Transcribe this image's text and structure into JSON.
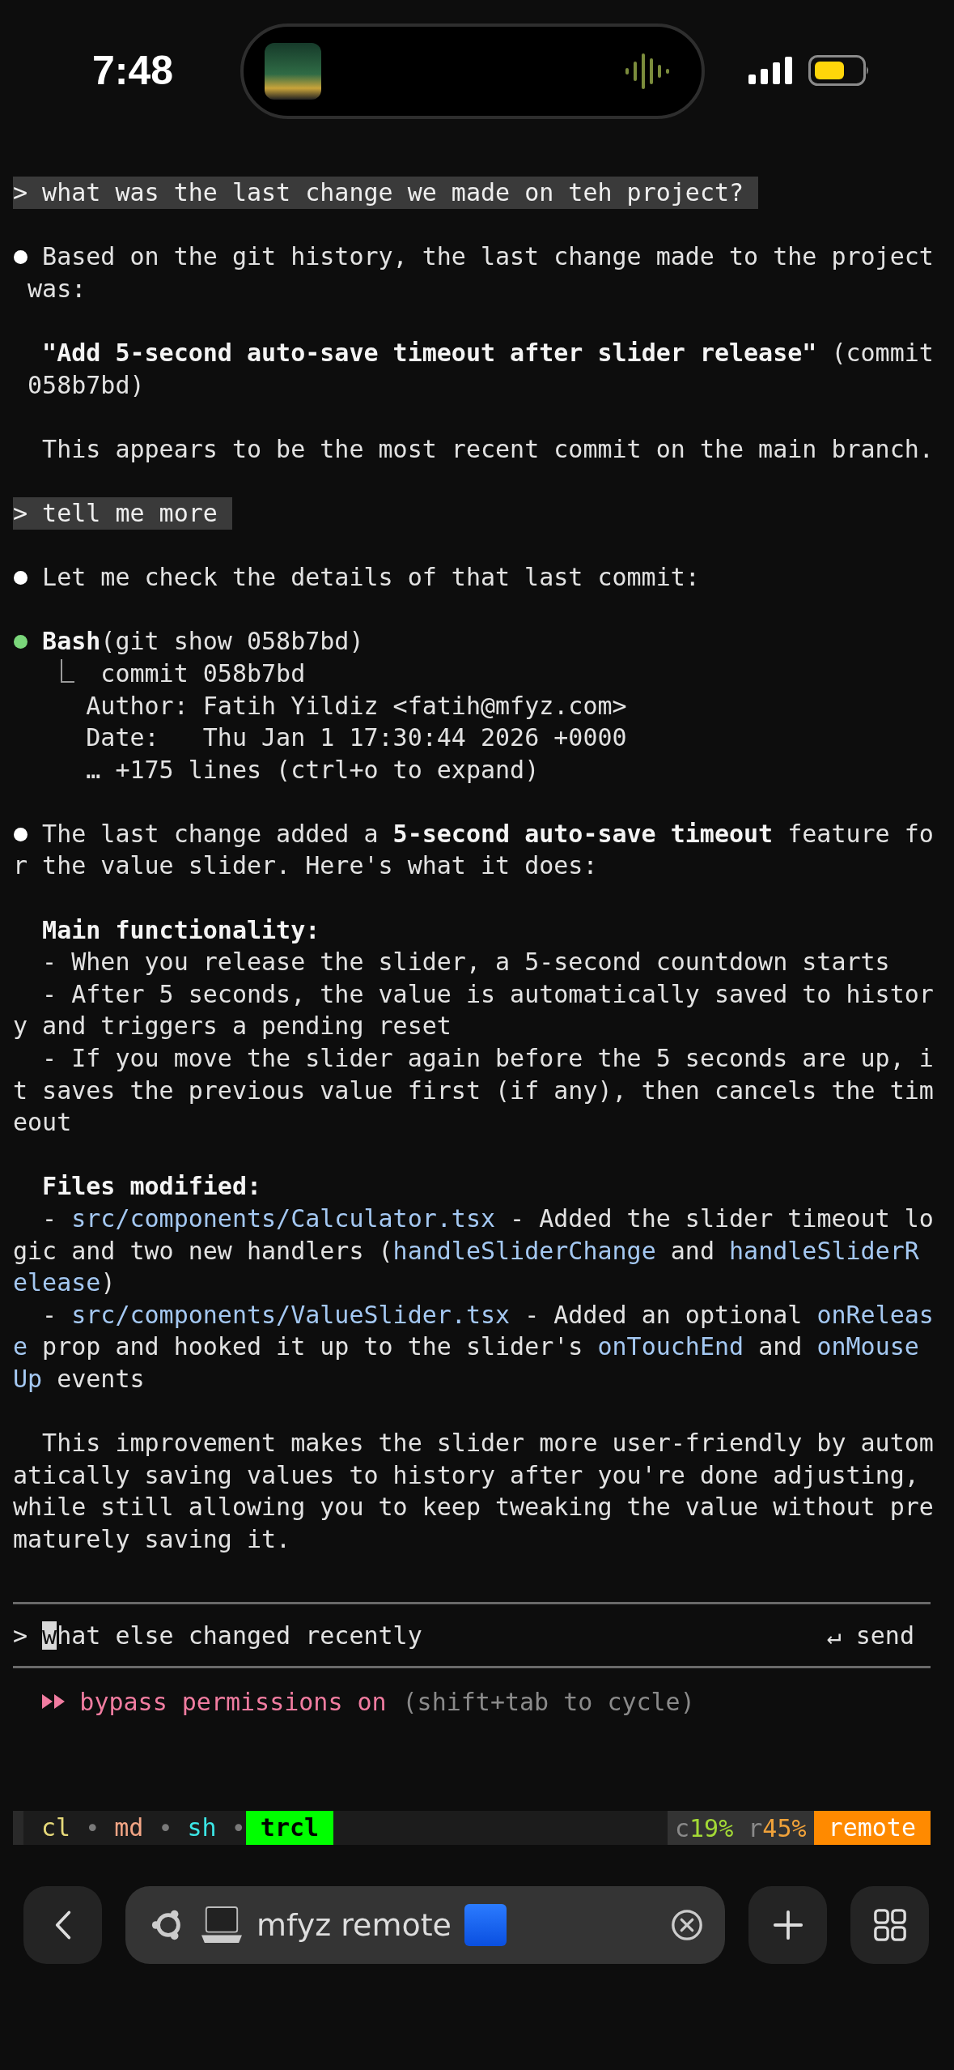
{
  "status_bar": {
    "time": "7:48"
  },
  "conversation": [
    {
      "kind": "prompt",
      "text": "> what was the last change we made on teh project?"
    },
    {
      "kind": "reply",
      "color": "#ffffff",
      "segments": [
        {
          "kind": "plain",
          "text": "Based on the git history, the last change made to the project was:"
        }
      ]
    },
    {
      "kind": "text",
      "segments": [
        {
          "kind": "bold",
          "text": "\"Add 5-second auto-save timeout after slider release\""
        },
        {
          "kind": "plain",
          "text": " (commit 058b7bd)"
        }
      ]
    },
    {
      "kind": "text",
      "segments": [
        {
          "kind": "plain",
          "text": "This appears to be the most recent commit on the main branch."
        }
      ]
    },
    {
      "kind": "prompt",
      "text": "> tell me more"
    },
    {
      "kind": "reply",
      "color": "#ffffff",
      "segments": [
        {
          "kind": "plain",
          "text": "Let me check the details of that last commit:"
        }
      ]
    },
    {
      "kind": "tool",
      "color": "#7ad67a",
      "segments": [
        {
          "kind": "bold",
          "text": "Bash"
        },
        {
          "kind": "plain",
          "text": "(git show 058b7bd)"
        }
      ],
      "output": [
        "commit 058b7bd",
        "Author: Fatih Yildiz <fatih@mfyz.com>",
        "Date:   Thu Jan 1 17:30:44 2026 +0000",
        "… +175 lines (ctrl+o to expand)"
      ]
    },
    {
      "kind": "reply",
      "color": "#ffffff",
      "segments": [
        {
          "kind": "plain",
          "text": "The last change added a "
        },
        {
          "kind": "bold",
          "text": "5-second auto-save timeout"
        },
        {
          "kind": "plain",
          "text": " feature for the value slider. Here's what it does:"
        }
      ]
    },
    {
      "kind": "section",
      "heading": "Main functionality:",
      "items": [
        [
          {
            "kind": "plain",
            "text": "- When you release the slider, a 5-second countdown starts"
          }
        ],
        [
          {
            "kind": "plain",
            "text": "- After 5 seconds, the value is automatically saved to history and triggers a pending reset"
          }
        ],
        [
          {
            "kind": "plain",
            "text": "- If you move the slider again before the 5 seconds are up, it saves the previous value first (if any), then cancels the timeout"
          }
        ]
      ]
    },
    {
      "kind": "section",
      "heading": "Files modified:",
      "items": [
        [
          {
            "kind": "plain",
            "text": "- "
          },
          {
            "kind": "code",
            "text": "src/components/Calculator.tsx"
          },
          {
            "kind": "plain",
            "text": " - Added the slider timeout logic and two new handlers ("
          },
          {
            "kind": "code",
            "text": "handleSliderChange"
          },
          {
            "kind": "plain",
            "text": " and "
          },
          {
            "kind": "code",
            "text": "handleSliderRelease"
          },
          {
            "kind": "plain",
            "text": ")"
          }
        ],
        [
          {
            "kind": "plain",
            "text": "- "
          },
          {
            "kind": "code",
            "text": "src/components/ValueSlider.tsx"
          },
          {
            "kind": "plain",
            "text": " - Added an optional "
          },
          {
            "kind": "code",
            "text": "onRelease"
          },
          {
            "kind": "plain",
            "text": " prop and hooked it up to the slider's "
          },
          {
            "kind": "code",
            "text": "onTouchEnd"
          },
          {
            "kind": "plain",
            "text": " and "
          },
          {
            "kind": "code",
            "text": "onMouseUp"
          },
          {
            "kind": "plain",
            "text": " events"
          }
        ]
      ]
    },
    {
      "kind": "text",
      "segments": [
        {
          "kind": "plain",
          "text": "This improvement makes the slider more user-friendly by automatically saving values to history after you're done adjusting, while still allowing you to keep tweaking the value without prematurely saving it."
        }
      ]
    }
  ],
  "input": {
    "prompt": ">",
    "value": "what else changed recently",
    "cursor_at_start": true,
    "send_hint": "↵ send"
  },
  "mode": {
    "label": "bypass permissions on",
    "hint": "(shift+tab to cycle)"
  },
  "tmux": {
    "windows": [
      {
        "label": "cl",
        "color": "#e6d97a",
        "selected": false,
        "separator": "•"
      },
      {
        "label": "md",
        "color": "#f2a585",
        "selected": false,
        "separator": "•"
      },
      {
        "label": "sh",
        "color": "#3ce6e6",
        "selected": false,
        "separator": "•"
      },
      {
        "label": "trcl",
        "color": "#00ff00",
        "selected": true
      }
    ],
    "stats": [
      {
        "key": "c",
        "value": "19%",
        "color": "#a3d936"
      },
      {
        "key": "r",
        "value": "45%",
        "color": "#f0a23a"
      }
    ],
    "session": "remote"
  },
  "browser": {
    "title": "mfyz remote"
  }
}
